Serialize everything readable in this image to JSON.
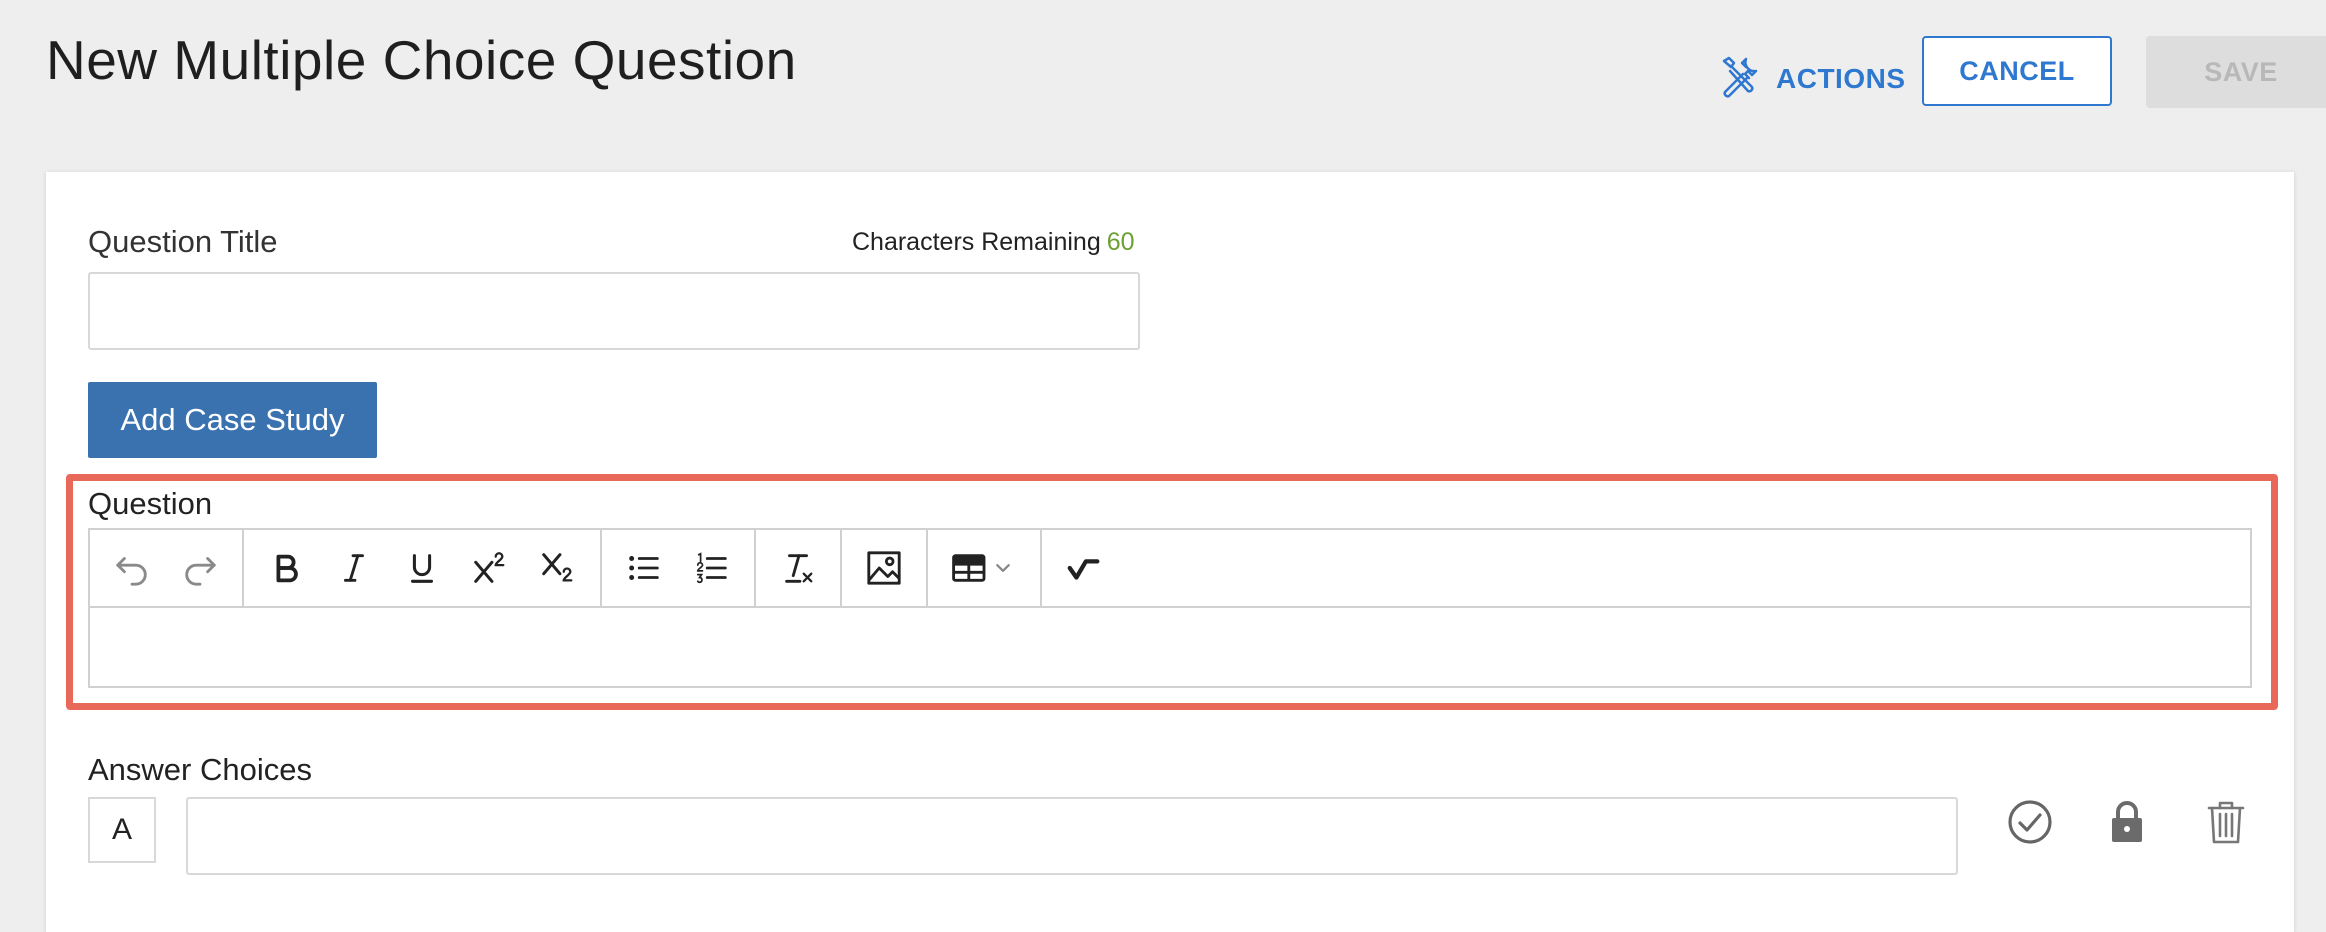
{
  "header": {
    "title": "New Multiple Choice Question",
    "actions_label": "ACTIONS",
    "cancel_label": "CANCEL",
    "save_label": "SAVE"
  },
  "form": {
    "question_title_label": "Question Title",
    "characters_remaining_label": "Characters Remaining",
    "characters_remaining_count": "60",
    "question_title_value": "",
    "add_case_study_label": "Add Case Study",
    "question_label": "Question",
    "answer_choices_label": "Answer Choices"
  },
  "toolbar": {
    "buttons": [
      "undo-icon",
      "redo-icon",
      "bold-icon",
      "italic-icon",
      "underline-icon",
      "superscript-icon",
      "subscript-icon",
      "bulleted-list-icon",
      "numbered-list-icon",
      "clear-formatting-icon",
      "image-icon",
      "table-icon",
      "math-icon"
    ]
  },
  "answer_choices": [
    {
      "letter": "A",
      "value": ""
    }
  ],
  "colors": {
    "accent": "#2f78d0",
    "primary_button": "#3a72b0",
    "highlight": "#e8695a",
    "count": "#6aa132"
  }
}
